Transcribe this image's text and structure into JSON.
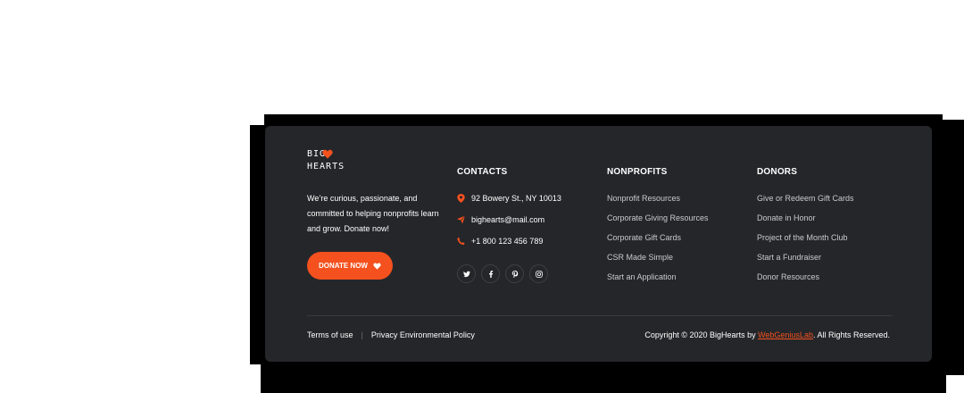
{
  "brand": {
    "logo_line1": "BIG",
    "logo_line2": "HEARTS",
    "accent_color": "#f4511e"
  },
  "about": {
    "text": "We’re curious, passionate, and committed to helping nonprofits learn and grow. Donate now!",
    "donate_label": "DONATE NOW",
    "donate_icon": "heart-icon"
  },
  "contacts": {
    "title": "CONTACTS",
    "address": "92 Bowery St., NY 10013",
    "email": "bighearts@mail.com",
    "phone": "+1 800 123 456 789",
    "socials": [
      "twitter-icon",
      "facebook-icon",
      "pinterest-icon",
      "instagram-icon"
    ]
  },
  "nonprofits": {
    "title": "NONPROFITS",
    "links": [
      "Nonprofit Resources",
      "Corporate Giving Resources",
      "Corporate Gift Cards",
      "CSR Made Simple",
      "Start an Application"
    ]
  },
  "donors": {
    "title": "DONORS",
    "links": [
      "Give or Redeem Gift Cards",
      "Donate in Honor",
      "Project of the Month Club",
      "Start a Fundraiser",
      "Donor Resources"
    ]
  },
  "bottom": {
    "terms": "Terms of use",
    "separator": "|",
    "privacy": "Privacy Environmental Policy",
    "copyright_prefix": "Copyright © 2020 BigHearts by ",
    "copyright_link": "WebGeniusLab",
    "copyright_suffix": ". All Rights Reserved."
  }
}
